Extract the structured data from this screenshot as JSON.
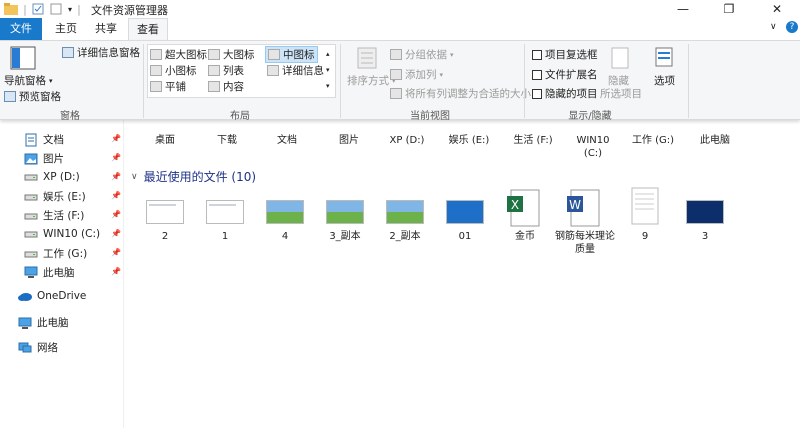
{
  "window": {
    "title": "文件资源管理器",
    "minimize": "—",
    "maximize": "❐",
    "close": "✕",
    "help": "?"
  },
  "tabs": [
    "文件",
    "主页",
    "共享",
    "查看"
  ],
  "ribbon": {
    "panes": {
      "nav_pane": "导航窗格",
      "preview": "预览窗格",
      "details": "详细信息窗格",
      "group": "窗格"
    },
    "layout": {
      "xl": "超大图标",
      "l": "大图标",
      "m": "中图标",
      "s": "小图标",
      "list": "列表",
      "details": "详细信息",
      "tiles": "平铺",
      "content": "内容",
      "group": "布局"
    },
    "current_view": {
      "sort": "排序方式",
      "groupby": "分组依据",
      "addcol": "添加列",
      "fit": "将所有列调整为合适的大小",
      "group": "当前视图"
    },
    "show_hide": {
      "checkbox": "项目复选框",
      "ext": "文件扩展名",
      "hidden": "隐藏的项目",
      "hide_sel_1": "隐藏",
      "hide_sel_2": "所选项目",
      "options": "选项",
      "group": "显示/隐藏"
    }
  },
  "sidebar": {
    "items": [
      {
        "label": "文档",
        "icon": "document-icon",
        "pinned": true
      },
      {
        "label": "图片",
        "icon": "pictures-icon",
        "pinned": true
      },
      {
        "label": "XP (D:)",
        "icon": "drive-icon",
        "pinned": true
      },
      {
        "label": "娱乐 (E:)",
        "icon": "drive-icon",
        "pinned": true
      },
      {
        "label": "生活 (F:)",
        "icon": "drive-icon",
        "pinned": true
      },
      {
        "label": "WIN10 (C:)",
        "icon": "drive-icon",
        "pinned": true
      },
      {
        "label": "工作 (G:)",
        "icon": "drive-icon",
        "pinned": true
      },
      {
        "label": "此电脑",
        "icon": "computer-icon",
        "pinned": true
      }
    ],
    "roots": [
      "OneDrive",
      "此电脑",
      "网络"
    ],
    "pin_glyph": "📌"
  },
  "frequent": [
    "桌面",
    "下载",
    "文档",
    "图片",
    "XP (D:)",
    "娱乐 (E:)",
    "生活 (F:)",
    "WIN10\n(C:)",
    "工作 (G:)",
    "此电脑"
  ],
  "recent": {
    "header": "最近使用的文件 (10)",
    "items": [
      {
        "name": "2",
        "kind": "doc-white"
      },
      {
        "name": "1",
        "kind": "doc-white"
      },
      {
        "name": "4",
        "kind": "landscape"
      },
      {
        "name": "3_副本",
        "kind": "landscape"
      },
      {
        "name": "2_副本",
        "kind": "landscape"
      },
      {
        "name": "01",
        "kind": "win7"
      },
      {
        "name": "金币",
        "kind": "excel"
      },
      {
        "name": "钢筋每米理论质量",
        "kind": "word"
      },
      {
        "name": "9",
        "kind": "doc-page"
      },
      {
        "name": "3",
        "kind": "dark"
      }
    ]
  },
  "colors": {
    "accent": "#1979ca",
    "section": "#1e3287",
    "highlight": "#cce4f7"
  }
}
